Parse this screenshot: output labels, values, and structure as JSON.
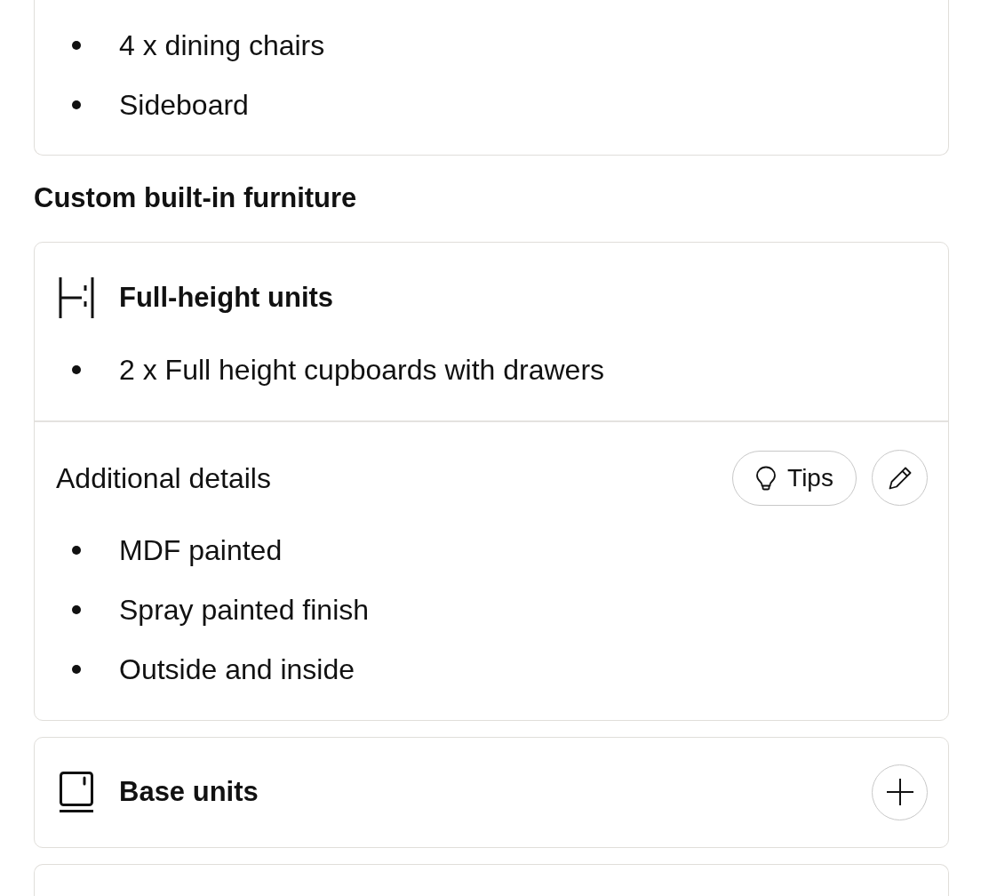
{
  "top_card": {
    "items": [
      "4 x dining chairs",
      "Sideboard"
    ]
  },
  "section_heading": "Custom built-in furniture",
  "units": [
    {
      "kind": "full-height",
      "title": "Full-height units",
      "expanded": true,
      "items": [
        "2 x Full height cupboards with drawers"
      ],
      "additional_details": {
        "label": "Additional details",
        "tips_button": "Tips",
        "items": [
          "MDF painted",
          "Spray painted finish",
          "Outside and inside"
        ]
      }
    },
    {
      "kind": "base",
      "title": "Base units",
      "expanded": false
    }
  ],
  "more_below": true
}
